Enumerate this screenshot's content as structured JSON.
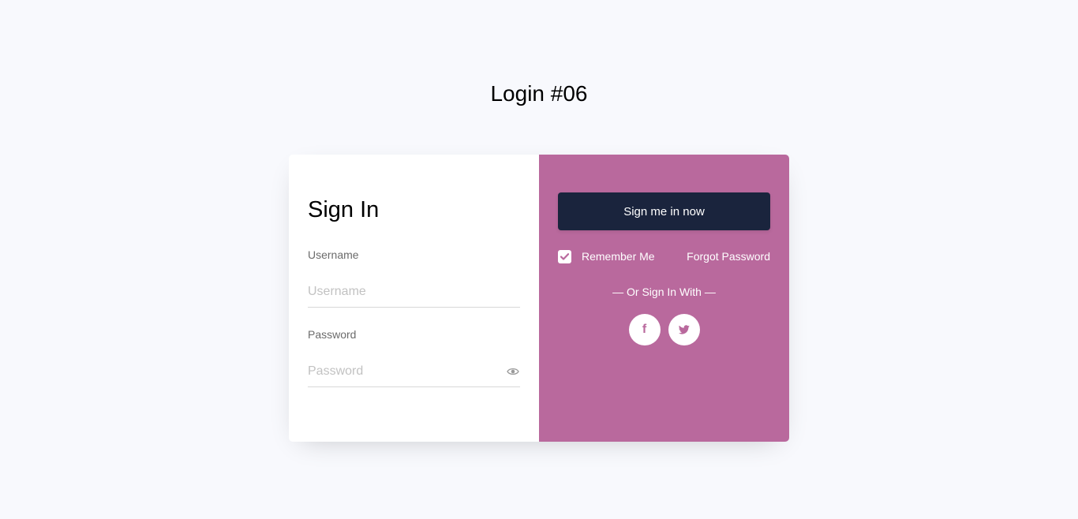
{
  "page": {
    "title": "Login #06"
  },
  "form": {
    "heading": "Sign In",
    "username_label": "Username",
    "username_placeholder": "Username",
    "username_value": "",
    "password_label": "Password",
    "password_placeholder": "Password",
    "password_value": "",
    "password_toggle_icon": "eye-icon"
  },
  "actions": {
    "submit_label": "Sign me in now",
    "remember_label": "Remember Me",
    "remember_checked": true,
    "forgot_label": "Forgot Password",
    "social_divider": "— Or Sign In With —",
    "social": [
      {
        "name": "facebook",
        "icon": "facebook-icon"
      },
      {
        "name": "twitter",
        "icon": "twitter-icon"
      }
    ]
  },
  "colors": {
    "background": "#f8f9fd",
    "accent_panel": "#b9699d",
    "button": "#1a243d",
    "card": "#ffffff"
  }
}
